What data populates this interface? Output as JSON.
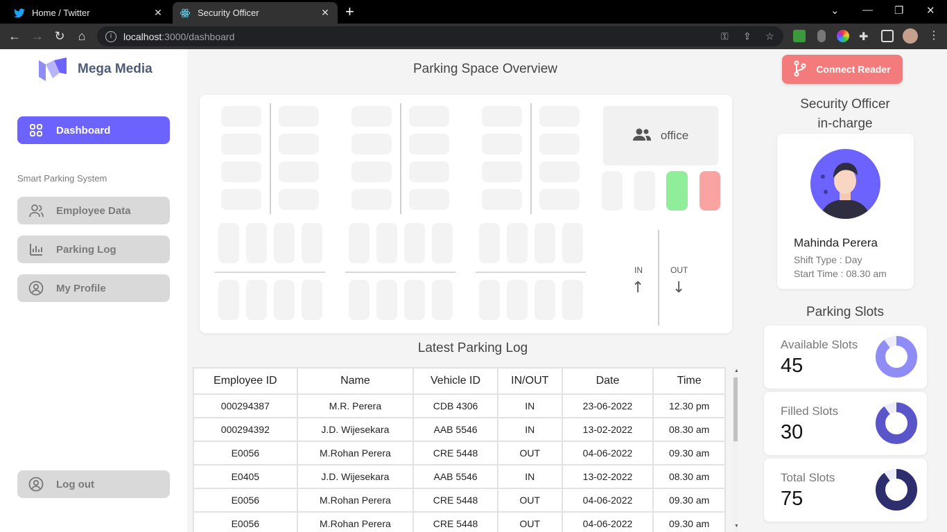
{
  "browser": {
    "tabs": [
      {
        "title": "Home / Twitter",
        "icon": "twitter-icon"
      },
      {
        "title": "Security Officer",
        "icon": "react-icon"
      }
    ],
    "url_host": "localhost",
    "url_path": ":3000/dashboard"
  },
  "sidebar": {
    "brand": "Mega Media",
    "dashboard_label": "Dashboard",
    "section_label": "Smart Parking System",
    "items": [
      {
        "label": "Employee Data",
        "icon": "user-icon"
      },
      {
        "label": "Parking Log",
        "icon": "bar-chart-icon"
      },
      {
        "label": "My Profile",
        "icon": "profile-icon"
      }
    ],
    "logout_label": "Log out"
  },
  "main": {
    "overview_title": "Parking Space Overview",
    "office_label": "office",
    "in_label": "IN",
    "out_label": "OUT",
    "status_colors": {
      "free": "#90ee9a",
      "occupied": "#f9a3a3",
      "empty": "#f3f3f3"
    },
    "log_title": "Latest Parking Log",
    "log_columns": [
      "Employee ID",
      "Name",
      "Vehicle ID",
      "IN/OUT",
      "Date",
      "Time"
    ],
    "log_rows": [
      [
        "000294387",
        "M.R. Perera",
        "CDB 4306",
        "IN",
        "23-06-2022",
        "12.30 pm"
      ],
      [
        "000294392",
        "J.D. Wijesekara",
        "AAB 5546",
        "IN",
        "13-02-2022",
        "08.30 am"
      ],
      [
        "E0056",
        "M.Rohan Perera",
        "CRE 5448",
        "OUT",
        "04-06-2022",
        "09.30 am"
      ],
      [
        "E0405",
        "J.D. Wijesekara",
        "AAB 5546",
        "IN",
        "13-02-2022",
        "08.30 am"
      ],
      [
        "E0056",
        "M.Rohan Perera",
        "CRE 5448",
        "OUT",
        "04-06-2022",
        "09.30 am"
      ],
      [
        "E0056",
        "M.Rohan Perera",
        "CRE 5448",
        "OUT",
        "04-06-2022",
        "09.30 am"
      ]
    ]
  },
  "right": {
    "connect_label": "Connect Reader",
    "officer_title_line1": "Security Officer",
    "officer_title_line2": "in-charge",
    "officer_name": "Mahinda Perera",
    "shift_type": "Shift Type : Day",
    "start_time": "Start Time : 08.30 am",
    "slots_title": "Parking Slots",
    "available_label": "Available Slots",
    "available_value": "45",
    "filled_label": "Filled Slots",
    "filled_value": "30",
    "total_label": "Total Slots",
    "total_value": "75",
    "colors": {
      "available": "#8f8cf5",
      "filled": "#5a56c9",
      "total": "#2e2d6e",
      "brand": "#6c63ff",
      "connect": "#f47b7b"
    }
  }
}
